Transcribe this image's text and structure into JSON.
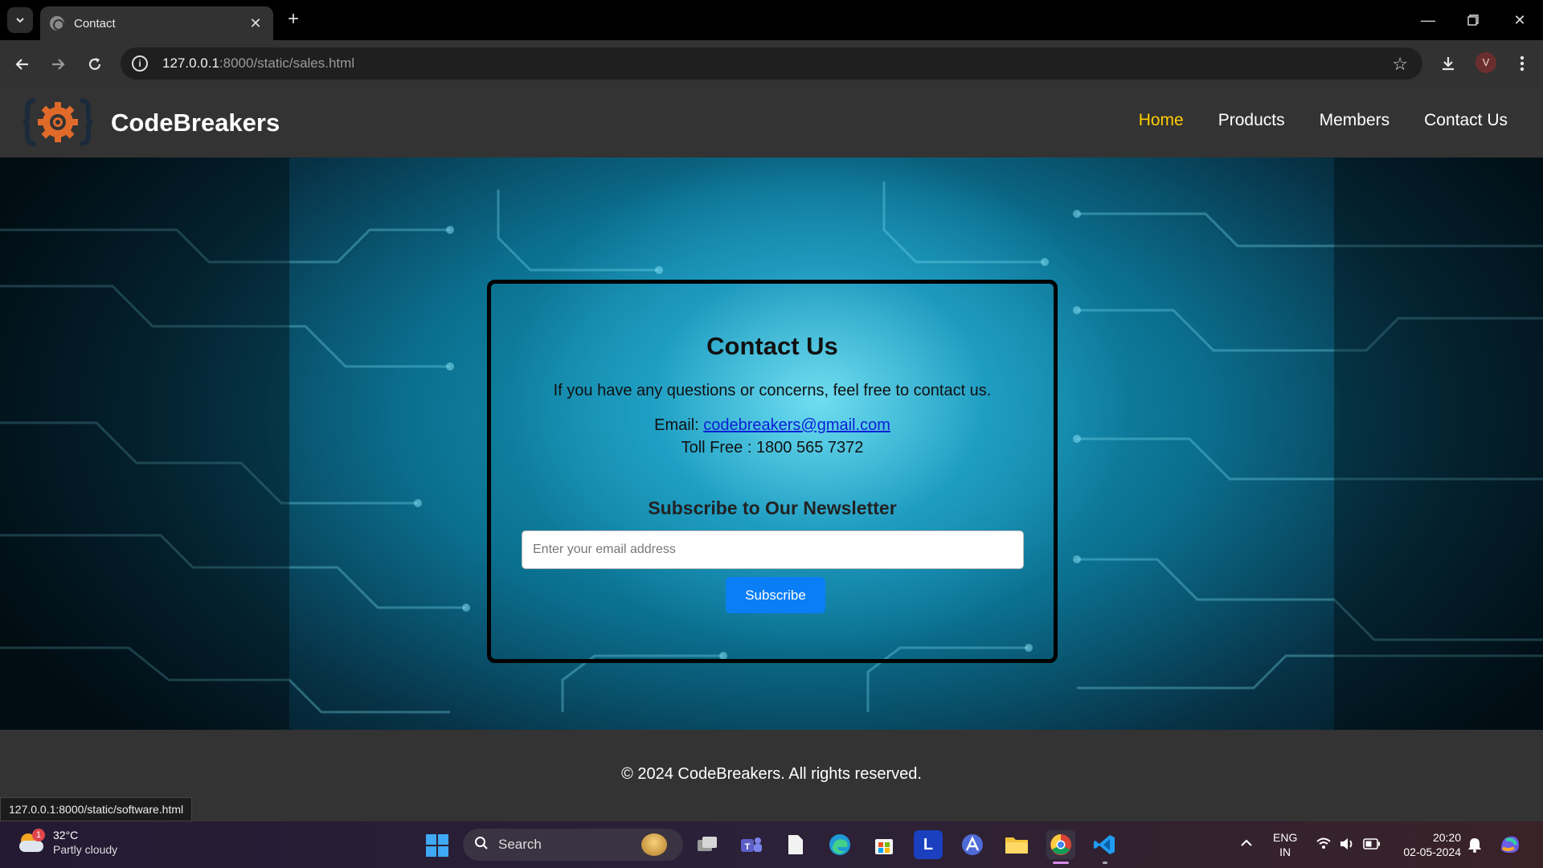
{
  "browser": {
    "tab_title": "Contact",
    "new_tab": "+",
    "url_host": "127.0.0.1",
    "url_path": ":8000/static/sales.html",
    "profile_initial": "V"
  },
  "site": {
    "brand": "CodeBreakers",
    "nav": [
      {
        "label": "Home",
        "active": true
      },
      {
        "label": "Products",
        "active": false
      },
      {
        "label": "Members",
        "active": false
      },
      {
        "label": "Contact Us",
        "active": false
      }
    ]
  },
  "contact": {
    "heading": "Contact Us",
    "intro": "If you have any questions or concerns, feel free to contact us.",
    "email_label": "Email: ",
    "email": "codebreakers@gmail.com",
    "toll_free": "Toll Free : 1800 565 7372",
    "newsletter_heading": "Subscribe to Our Newsletter",
    "email_placeholder": "Enter your email address",
    "subscribe_label": "Subscribe"
  },
  "footer": {
    "copyright": "© 2024 CodeBreakers. All rights reserved."
  },
  "status_bar": {
    "hover_url": "127.0.0.1:8000/static/software.html"
  },
  "taskbar": {
    "weather_temp": "32°C",
    "weather_condition": "Partly cloudy",
    "weather_badge": "1",
    "search_label": "Search",
    "lang_top": "ENG",
    "lang_bottom": "IN",
    "time": "20:20",
    "date": "02-05-2024"
  },
  "colors": {
    "nav_active": "#ffcc00",
    "subscribe_button": "#0a7ef7",
    "header_bg": "#333333",
    "link": "#0b1fd6"
  },
  "icons": [
    "tab-list-icon",
    "globe-icon",
    "close-icon",
    "minimize-icon",
    "restore-icon",
    "back-icon",
    "forward-icon",
    "reload-icon",
    "site-info-icon",
    "bookmark-star-icon",
    "download-icon",
    "menu-kebab-icon",
    "gear-logo-icon",
    "windows-start-icon",
    "search-icon"
  ]
}
